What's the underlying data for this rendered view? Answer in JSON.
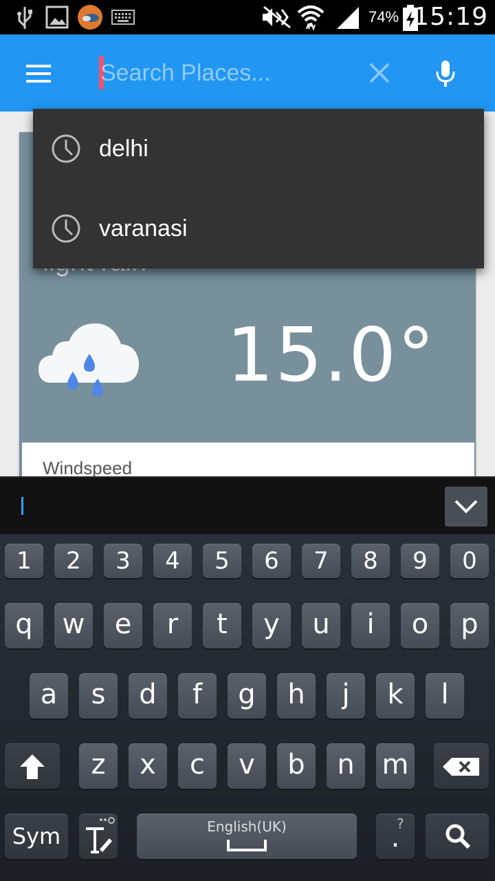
{
  "status_bar": {
    "battery_percent": "74%",
    "time": "15:19",
    "icons": [
      "usb-icon",
      "image-icon",
      "weather-app-icon",
      "keyboard-icon",
      "mute-icon",
      "wifi-icon",
      "signal-icon",
      "battery-charging-icon"
    ]
  },
  "appbar": {
    "color": "#2196f3",
    "search_placeholder": "Search Places...",
    "icons": [
      "menu-icon",
      "clear-icon",
      "mic-icon"
    ]
  },
  "suggestions": [
    {
      "label": "delhi",
      "icon": "history-clock-icon"
    },
    {
      "label": "varanasi",
      "icon": "history-clock-icon"
    }
  ],
  "weather": {
    "description": "light rain",
    "temperature": "15.0°",
    "details_label": "Windspeed",
    "icon": "rain-cloud-icon"
  },
  "keyboard": {
    "numbers": [
      "1",
      "2",
      "3",
      "4",
      "5",
      "6",
      "7",
      "8",
      "9",
      "0"
    ],
    "row1": [
      "q",
      "w",
      "e",
      "r",
      "t",
      "y",
      "u",
      "i",
      "o",
      "p"
    ],
    "row2": [
      "a",
      "s",
      "d",
      "f",
      "g",
      "h",
      "j",
      "k",
      "l"
    ],
    "row3": [
      "z",
      "x",
      "c",
      "v",
      "b",
      "n",
      "m"
    ],
    "sym_label": "Sym",
    "space_label": "English(UK)",
    "period_label": ".",
    "period_hint": "?"
  }
}
